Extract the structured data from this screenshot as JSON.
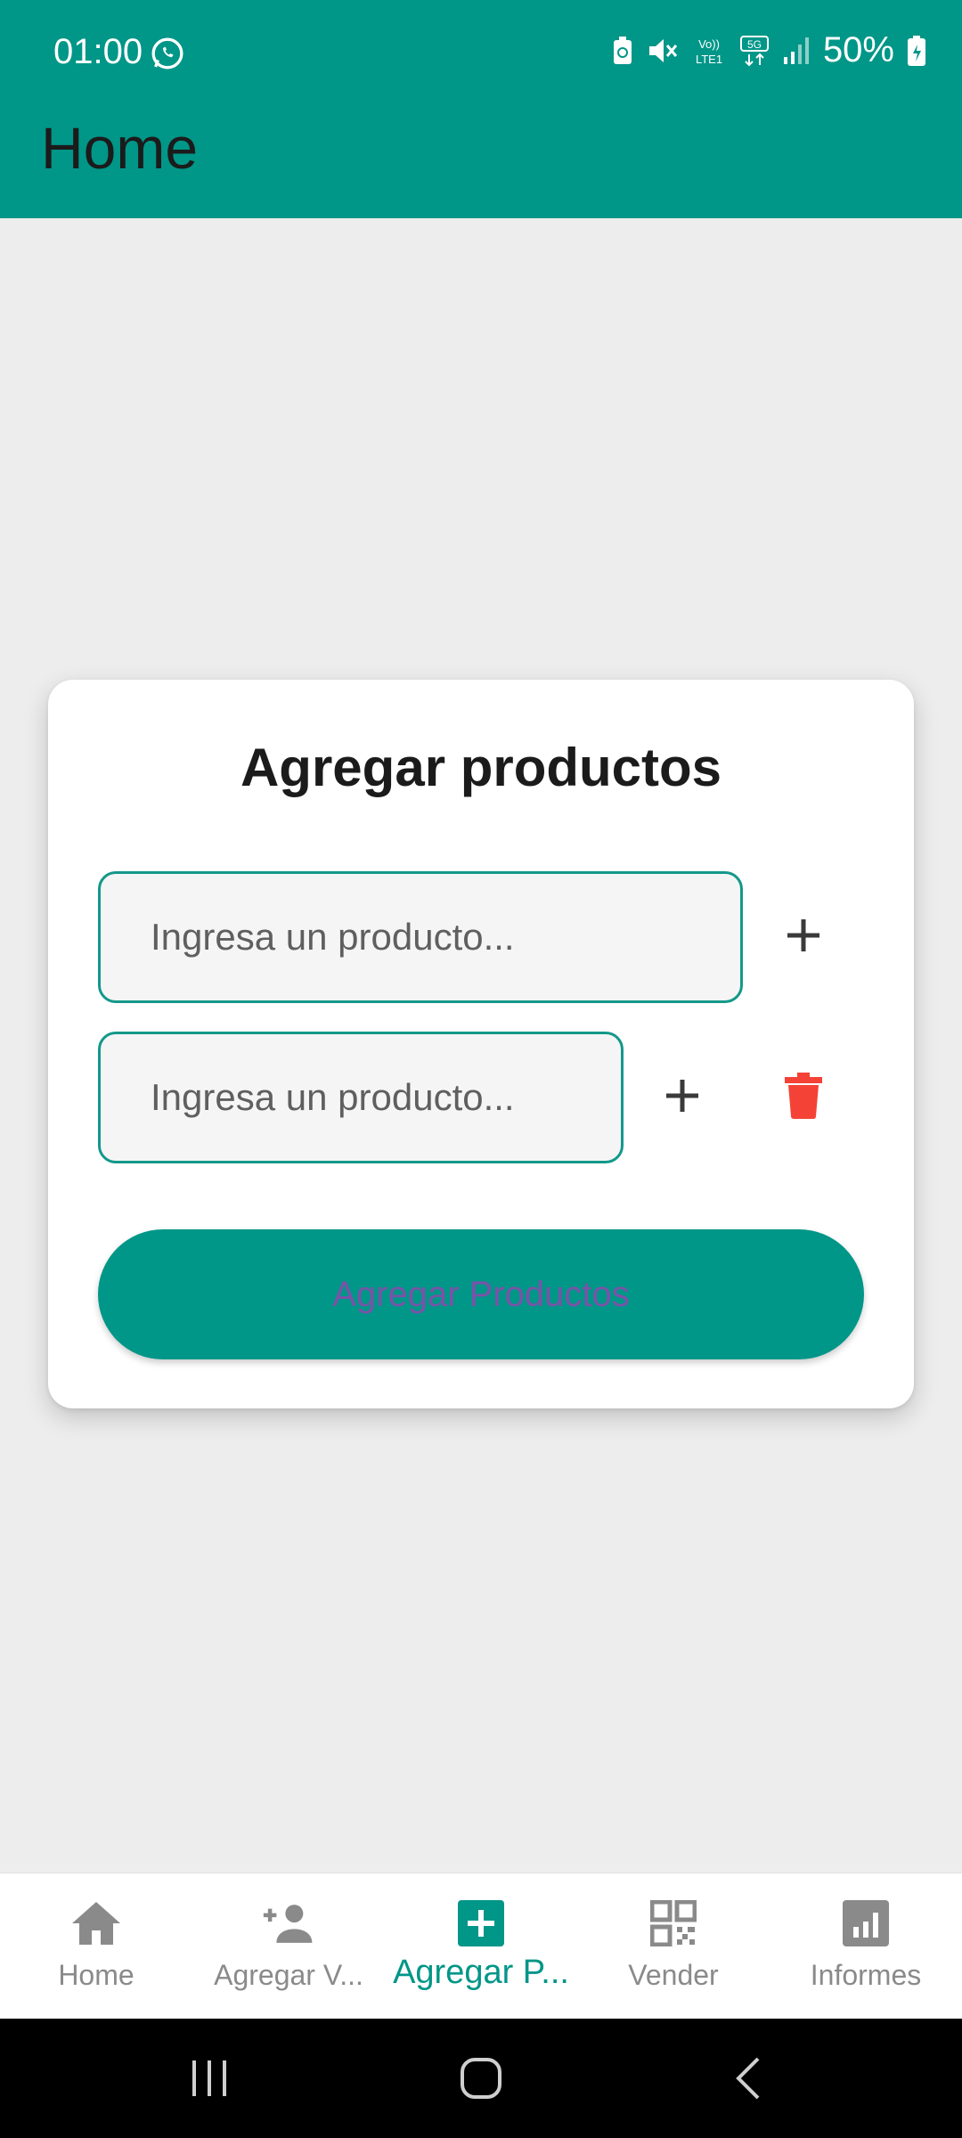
{
  "status_bar": {
    "time": "01:00",
    "battery": "50%",
    "icons": [
      "whatsapp-icon",
      "recycle-battery-icon",
      "mute-icon",
      "volte-icon",
      "5g-icon",
      "signal-icon",
      "battery-icon"
    ]
  },
  "header": {
    "title": "Home"
  },
  "card": {
    "title": "Agregar productos",
    "inputs": [
      {
        "placeholder": "Ingresa un producto...",
        "value": ""
      },
      {
        "placeholder": "Ingresa un producto...",
        "value": ""
      }
    ],
    "submit_label": "Agregar Productos"
  },
  "bottom_nav": {
    "items": [
      {
        "label": "Home",
        "icon": "home-icon"
      },
      {
        "label": "Agregar V...",
        "icon": "add-person-icon"
      },
      {
        "label": "Agregar P...",
        "icon": "add-box-icon"
      },
      {
        "label": "Vender",
        "icon": "qr-code-icon"
      },
      {
        "label": "Informes",
        "icon": "chart-icon"
      }
    ],
    "active_index": 2
  },
  "colors": {
    "primary": "#009688",
    "background": "#ededed",
    "delete": "#f44336",
    "submit_text": "#7b52a8"
  }
}
